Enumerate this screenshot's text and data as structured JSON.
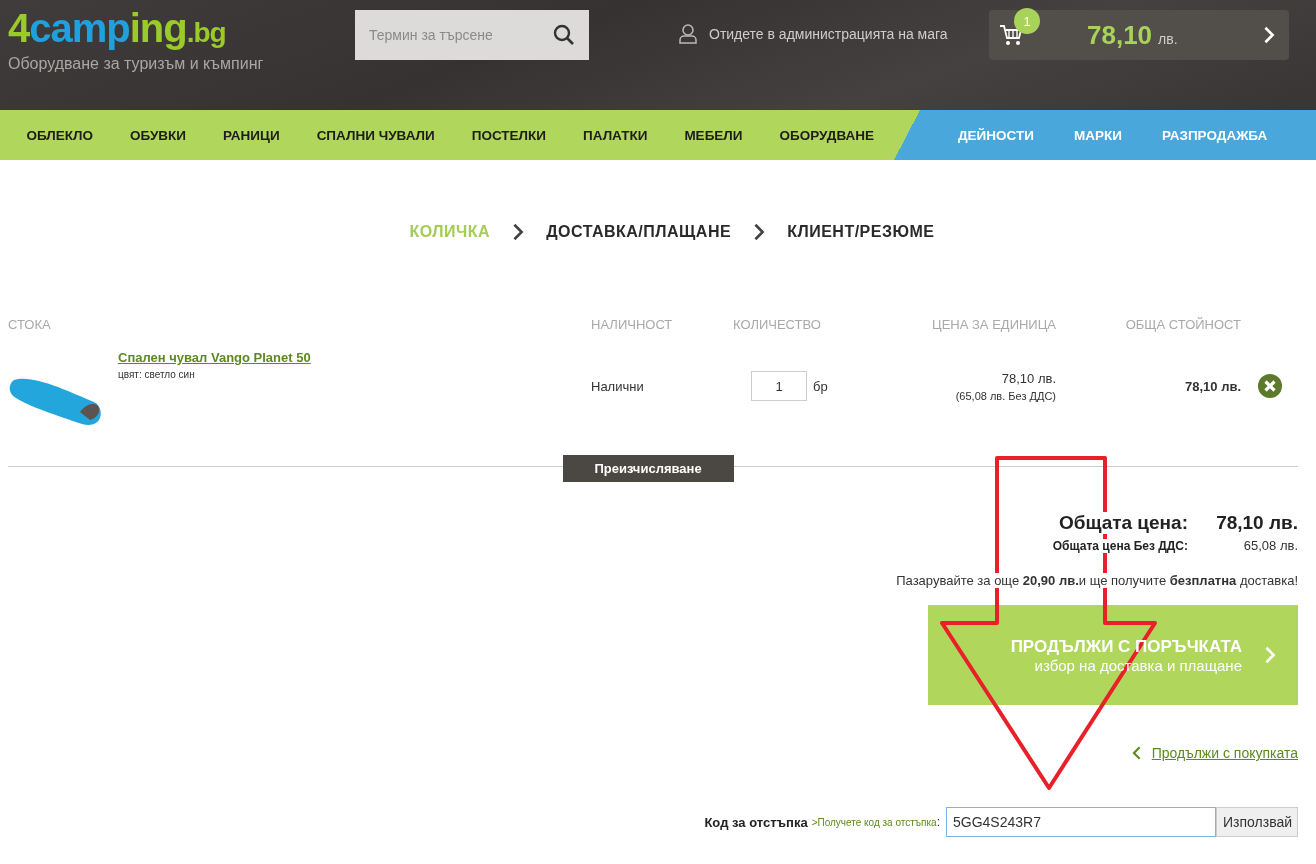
{
  "header": {
    "logo": {
      "number": "4",
      "brand": "camp",
      "brand_accent": "ing",
      "tld": ".bg",
      "tagline": "Оборудване за туризъм и къмпинг"
    },
    "search": {
      "placeholder": "Термин за търсене"
    },
    "account_link": "Отидете в администрацията на мага",
    "cart": {
      "count": "1",
      "amount": "78,10",
      "currency": "лв."
    }
  },
  "nav": [
    {
      "label": "ОБЛЕКЛО",
      "kind": "main"
    },
    {
      "label": "ОБУВКИ",
      "kind": "main"
    },
    {
      "label": "РАНИЦИ",
      "kind": "main"
    },
    {
      "label": "СПАЛНИ ЧУВАЛИ",
      "kind": "main"
    },
    {
      "label": "ПОСТЕЛКИ",
      "kind": "main"
    },
    {
      "label": "ПАЛАТКИ",
      "kind": "main"
    },
    {
      "label": "МЕБЕЛИ",
      "kind": "main"
    },
    {
      "label": "ОБОРУДВАНЕ",
      "kind": "main"
    },
    {
      "label": "ДЕЙНОСТИ",
      "kind": "extra"
    },
    {
      "label": "МАРКИ",
      "kind": "extra"
    },
    {
      "label": "РАЗПРОДАЖБА",
      "kind": "extra"
    }
  ],
  "steps": [
    {
      "label": "КОЛИЧКА",
      "selected": true
    },
    {
      "label": "ДОСТАВКА/ПЛАЩАНЕ",
      "selected": false
    },
    {
      "label": "КЛИЕНТ/РЕЗЮМЕ",
      "selected": false
    }
  ],
  "table": {
    "columns": [
      "СТОКА",
      "НАЛИЧНОСТ",
      "КОЛИЧЕСТВО",
      "ЦЕНА ЗА ЕДИНИЦА",
      "ОБЩА СТОЙНОСТ"
    ],
    "rows": [
      {
        "name": "Спален чувал Vango Planet 50",
        "variant": "цвят: светло син",
        "availability": "Налични",
        "quantity": "1",
        "unit": "бр",
        "unit_price": "78,10 лв.",
        "unit_price_net": "(65,08 лв. Без ДДС)",
        "total": "78,10 лв."
      }
    ]
  },
  "recalculate_button": "Преизчисляване",
  "summary": {
    "total_label": "Общата цена:",
    "total": "78,10 лв.",
    "net_label": "Общата цена Без ДДС:",
    "net": "65,08 лв.",
    "free_shipping_note": "Пазарувайте за още **20,90 лв.**и ще получите **безплатна** доставка!"
  },
  "continue_button": {
    "title": "ПРОДЪЛЖИ С ПОРЪЧКАТА",
    "subtitle": "избор на доставка и плащане"
  },
  "continue_shopping_link": "Продължи с покупката",
  "discount": {
    "label": "Код за отстъпка",
    "link": ">Получете код за отстъпка",
    "colon": ":",
    "value": "5GG4S243R7",
    "button": "Използвай"
  },
  "annotation": {
    "kind": "arrow",
    "color": "#e8202a"
  }
}
